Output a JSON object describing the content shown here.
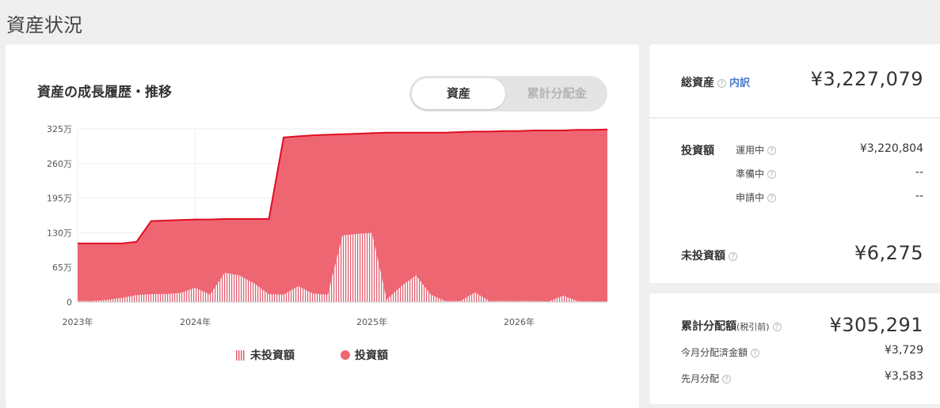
{
  "page": {
    "title": "資産状況"
  },
  "chart_card": {
    "title": "資産の成長履歴・推移",
    "toggle": {
      "active": "資産",
      "inactive": "累計分配金"
    }
  },
  "legend": {
    "uninvested": "未投資額",
    "invested": "投資額"
  },
  "summary": {
    "total_label": "総資産",
    "breakdown_link": "内訳",
    "total_value": "¥3,227,079",
    "invested_label": "投資額",
    "rows": [
      {
        "label": "運用中",
        "value": "¥3,220,804"
      },
      {
        "label": "準備中",
        "value": "--"
      },
      {
        "label": "申請中",
        "value": "--"
      }
    ],
    "uninvested_label": "未投資額",
    "uninvested_value": "¥6,275"
  },
  "distributions": {
    "cumulative_label": "累計分配額",
    "cumulative_note": "(税引前)",
    "cumulative_value": "¥305,291",
    "this_month_label": "今月分配済金額",
    "this_month_value": "¥3,729",
    "last_month_label": "先月分配",
    "last_month_value": "¥3,583"
  },
  "colors": {
    "accent_red": "#e00d22",
    "fill_red": "#ef6673",
    "link_blue": "#4a7cc9"
  },
  "chart_data": {
    "type": "area",
    "ylim": [
      0,
      325
    ],
    "y_ticks": [
      0,
      65,
      130,
      195,
      260,
      325
    ],
    "y_tick_labels": [
      "0",
      "65万",
      "130万",
      "195万",
      "260万",
      "325万"
    ],
    "x_tick_labels": [
      "2023年",
      "2024年",
      "2025年",
      "2026年"
    ],
    "x_tick_positions": [
      0,
      8,
      20,
      30
    ],
    "grid": true,
    "legend_position": "bottom",
    "series": [
      {
        "name": "投資額",
        "x": [
          0,
          1,
          2,
          3,
          4,
          5,
          6,
          7,
          8,
          9,
          10,
          11,
          12,
          13,
          14,
          15,
          16,
          17,
          18,
          19,
          20,
          21,
          22,
          23,
          24,
          25,
          26,
          27,
          28,
          29,
          30,
          31,
          32,
          33,
          34,
          35,
          36
        ],
        "values": [
          110,
          110,
          110,
          110,
          113,
          152,
          153,
          154,
          155,
          155,
          156,
          156,
          156,
          156,
          309,
          311,
          313,
          314,
          315,
          316,
          317,
          318,
          318,
          318,
          318,
          318,
          319,
          320,
          320,
          321,
          321,
          322,
          322,
          322,
          323,
          323,
          324
        ]
      },
      {
        "name": "未投資額",
        "x": [
          0,
          1,
          2,
          3,
          4,
          5,
          6,
          7,
          8,
          9,
          10,
          11,
          12,
          13,
          14,
          15,
          16,
          17,
          18,
          19,
          20,
          21,
          22,
          23,
          24,
          25,
          26,
          27,
          28,
          29,
          30,
          31,
          32,
          33,
          34,
          35,
          36
        ],
        "values": [
          2,
          2,
          4,
          8,
          13,
          15,
          15,
          17,
          27,
          14,
          55,
          50,
          35,
          15,
          14,
          30,
          16,
          14,
          125,
          128,
          130,
          5,
          30,
          50,
          14,
          2,
          2,
          18,
          2,
          2,
          2,
          2,
          1,
          12,
          2,
          1,
          1
        ]
      }
    ]
  }
}
